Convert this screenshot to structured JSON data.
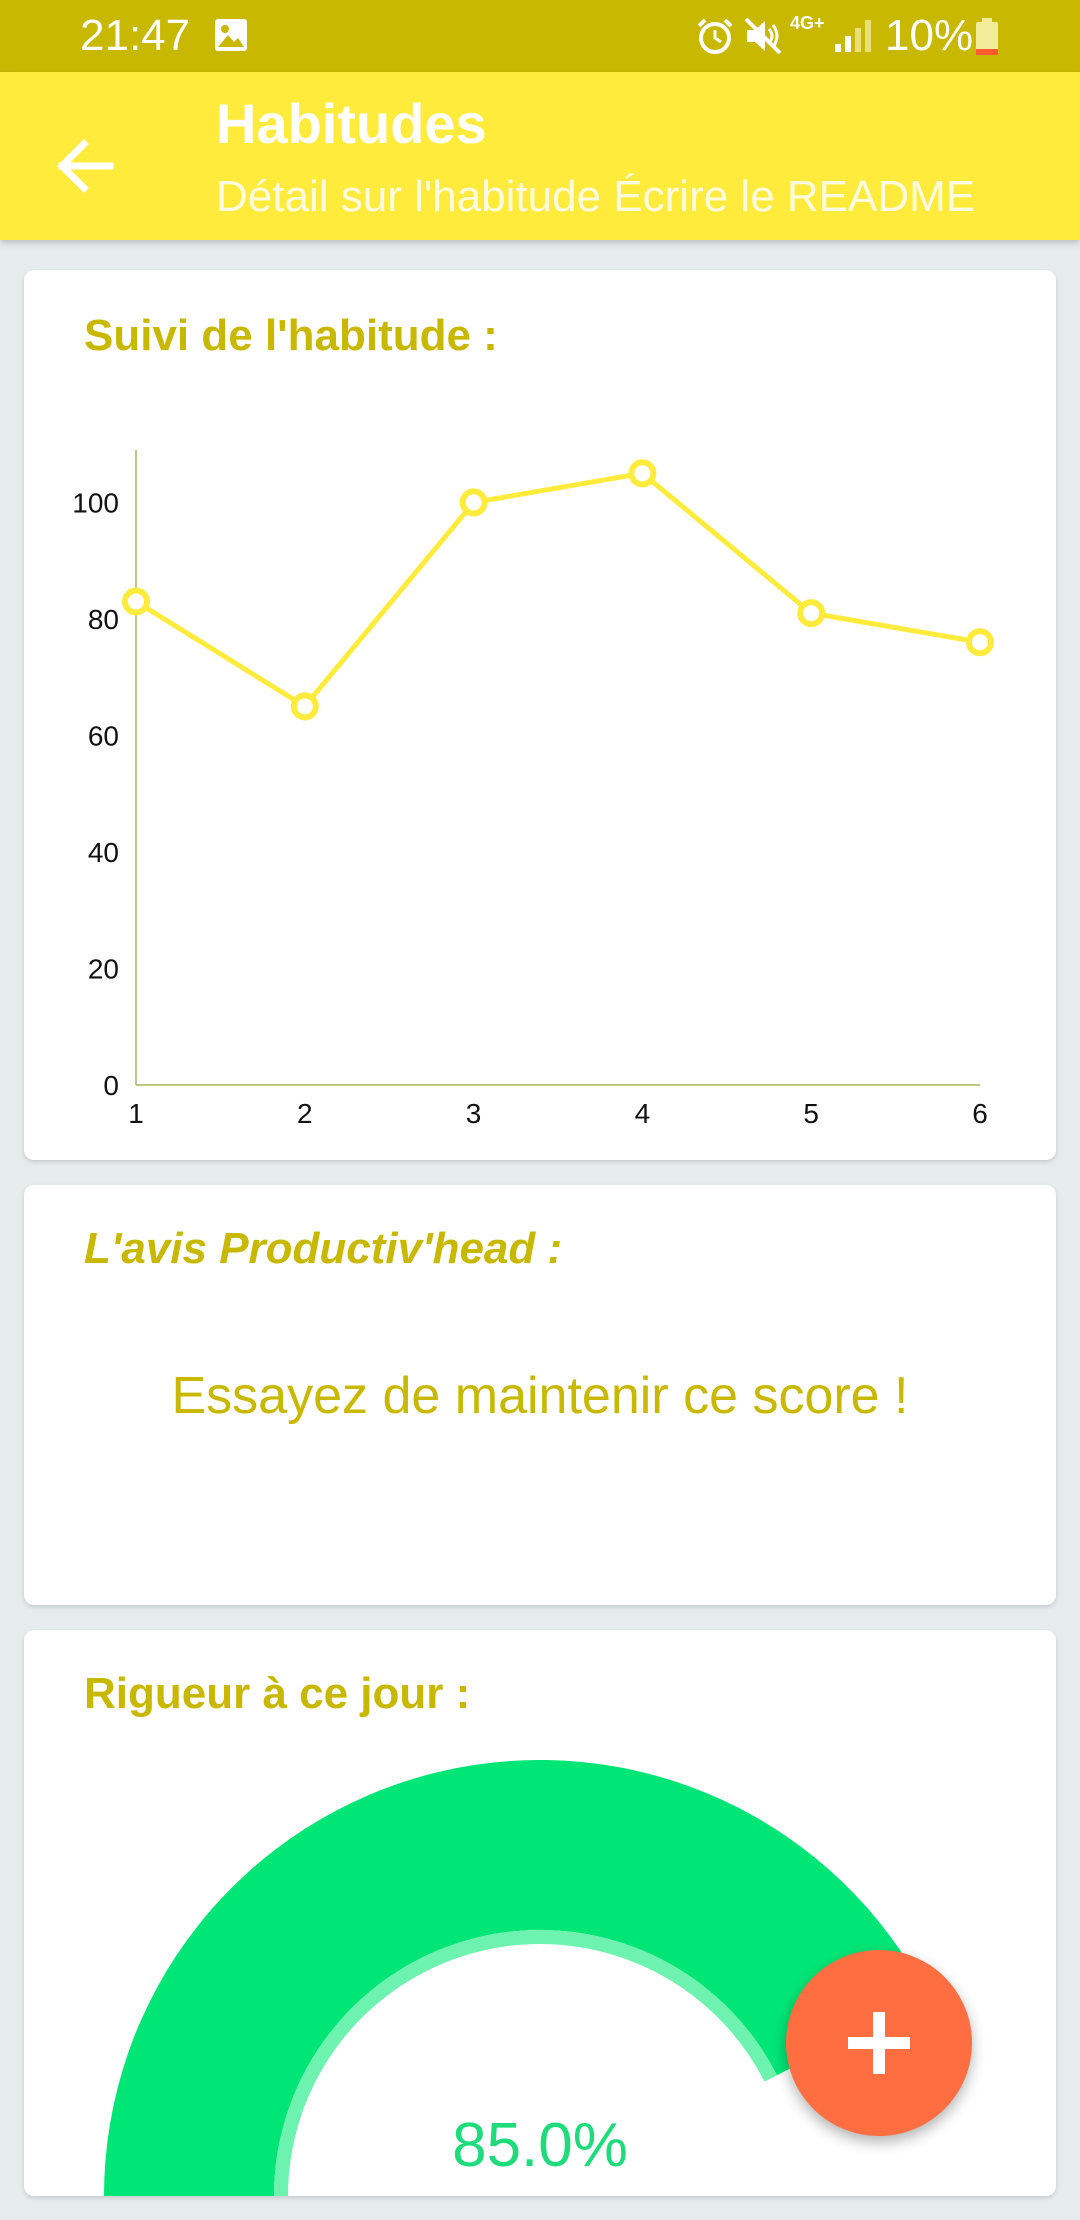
{
  "status_bar": {
    "time": "21:47",
    "network": "4G+",
    "battery": "10%",
    "icons": [
      "image-icon",
      "alarm-icon",
      "mute-icon",
      "signal-icon",
      "battery-icon"
    ]
  },
  "app_bar": {
    "title": "Habitudes",
    "subtitle": "Détail sur l'habitude Écrire le README"
  },
  "chart_card": {
    "title": "Suivi de l'habitude :"
  },
  "chart_data": {
    "type": "line",
    "x": [
      1,
      2,
      3,
      4,
      5,
      6
    ],
    "values": [
      83,
      65,
      100,
      105,
      81,
      76
    ],
    "yticks": [
      0,
      20,
      40,
      60,
      80,
      100
    ],
    "xlim": [
      1,
      6
    ],
    "ylim": [
      0,
      109
    ],
    "grid": false,
    "color": "#ffeb3b"
  },
  "avis_card": {
    "title": "L'avis Productiv'head :",
    "message": "Essayez de maintenir ce score !"
  },
  "rigueur_card": {
    "title": "Rigueur à ce jour :",
    "value_label": "85.0%",
    "value": 0.85,
    "color": "#00e676"
  },
  "fab": {
    "icon": "plus-icon",
    "color": "#ff6e40"
  }
}
